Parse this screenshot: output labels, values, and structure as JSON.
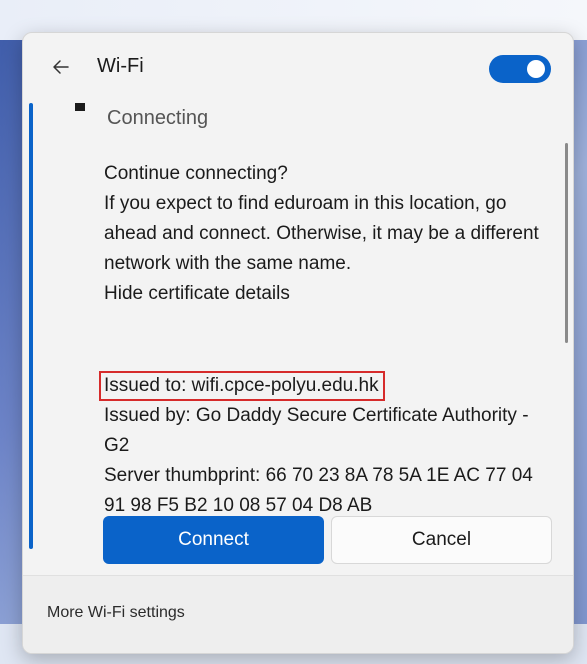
{
  "header": {
    "title": "Wi-Fi",
    "back_icon": "arrow-left-icon",
    "toggle_state": "on",
    "accent_color": "#0a63c9"
  },
  "network": {
    "status": "Connecting"
  },
  "prompt": {
    "question": "Continue connecting?",
    "explanation": "If you expect to find eduroam in this location, go ahead and connect. Otherwise, it may be a different network with the same name.",
    "toggle_details_link": "Hide certificate details"
  },
  "certificate": {
    "issued_to": "Issued to: wifi.cpce-polyu.edu.hk",
    "issued_by": "Issued by: Go Daddy Secure Certificate Authority - G2",
    "thumbprint": "Server thumbprint: 66 70 23 8A 78 5A 1E AC 77 04 91 98 F5 B2 10 08 57 04 D8 AB",
    "highlight_color": "#d62b2b"
  },
  "actions": {
    "connect_label": "Connect",
    "cancel_label": "Cancel"
  },
  "footer": {
    "more_settings_label": "More Wi-Fi settings"
  }
}
